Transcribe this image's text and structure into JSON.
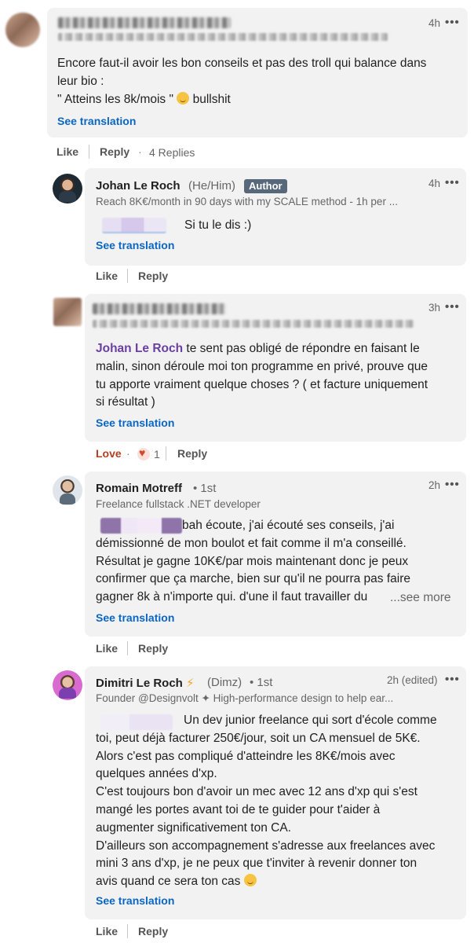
{
  "comment1": {
    "time": "4h",
    "text_line1": "Encore faut-il avoir les bon conseils et pas des troll qui balance dans",
    "text_line2": "leur bio :",
    "text_line3_a": "\" Atteins les 8k/mois \"",
    "text_line3_b": "bullshit",
    "see_translation": "See translation",
    "like": "Like",
    "reply": "Reply",
    "replies": "4 Replies"
  },
  "reply1": {
    "name": "Johan Le Roch",
    "pronoun": "(He/Him)",
    "badge": "Author",
    "headline": "Reach 8K€/month in 90 days with my SCALE method - 1h per ...",
    "time": "4h",
    "text": "Si tu le dis :)",
    "see_translation": "See translation",
    "like": "Like",
    "reply": "Reply"
  },
  "reply2": {
    "time": "3h",
    "mention": "Johan Le Roch",
    "line1": " te sent pas obligé de répondre en faisant le",
    "line2": "malin, sinon déroule moi ton programme en privé, prouve que",
    "line3": "tu apporte vraiment quelque choses ? ( et facture uniquement",
    "line4": "si résultat )",
    "see_translation": "See translation",
    "love": "Love",
    "reaction_count": "1",
    "reply": "Reply"
  },
  "reply3": {
    "name": "Romain Motreff",
    "degree": "• 1st",
    "headline": "Freelance fullstack .NET developer",
    "time": "2h",
    "line1": "bah écoute, j'ai écouté ses conseils, j'ai",
    "line2": "démissionné de mon boulot et fait comme il m'a conseillé.",
    "line3": "Résultat je gagne 10K€/par mois maintenant donc je peux",
    "line4": "confirmer que ça marche, bien sur qu'il ne pourra pas faire",
    "line5": "gagner 8k à n'importe qui. d'une il faut travailler du",
    "see_more": "...see more",
    "see_translation": "See translation",
    "like": "Like",
    "reply": "Reply"
  },
  "reply4": {
    "name": "Dimitri Le Roch",
    "pronoun": "(Dimz)",
    "degree": "• 1st",
    "headline": "Founder @Designvolt ✦ High-performance design to help ear...",
    "time": "2h (edited)",
    "line1": "Un dev junior freelance qui sort d'école comme",
    "line2": "toi, peut déjà facturer 250€/jour, soit un CA mensuel de 5K€.",
    "line3": "Alors c'est pas compliqué d'atteindre les 8K€/mois avec",
    "line4": "quelques années d'xp.",
    "line5": "C'est toujours bon d'avoir un mec avec 12 ans d'xp qui s'est",
    "line6": "mangé les portes avant toi de te guider pour t'aider à",
    "line7": "augmenter significativement ton CA.",
    "line8": "D'ailleurs son accompagnement s'adresse aux freelances avec",
    "line9": "mini 3 ans d'xp, je ne peux que t'inviter à revenir donner ton",
    "line10": "avis quand ce sera ton cas",
    "see_translation": "See translation",
    "like": "Like",
    "reply": "Reply"
  },
  "more_icon": "•••"
}
